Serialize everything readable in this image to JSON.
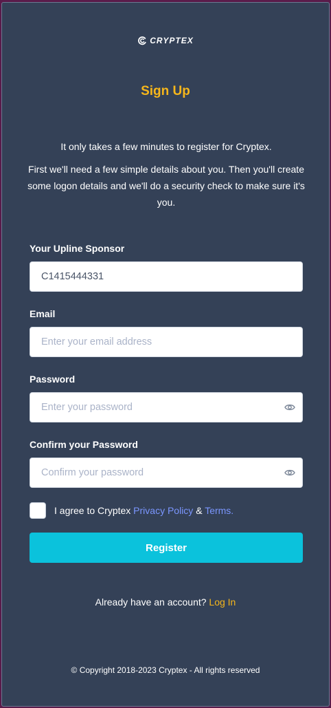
{
  "brand": {
    "name": "CRYPTEX",
    "logo_icon": "cryptex-swirl-icon"
  },
  "page": {
    "title": "Sign Up",
    "intro_line1": "It only takes a few minutes to register for Cryptex.",
    "intro_line2": "First we'll need a few simple details about you. Then you'll create some logon details and we'll do a security check to make sure it's you."
  },
  "form": {
    "sponsor": {
      "label": "Your Upline Sponsor",
      "value": "C1415444331",
      "placeholder": ""
    },
    "email": {
      "label": "Email",
      "value": "",
      "placeholder": "Enter your email address"
    },
    "password": {
      "label": "Password",
      "value": "",
      "placeholder": "Enter your password",
      "icon": "eye-icon"
    },
    "confirm_password": {
      "label": "Confirm your Password",
      "value": "",
      "placeholder": "Confirm your password",
      "icon": "eye-icon"
    },
    "agree": {
      "checked": false,
      "prefix": "I agree to Cryptex",
      "privacy_link": "Privacy Policy",
      "joiner": "&",
      "terms_link": "Terms."
    },
    "register_label": "Register"
  },
  "footer": {
    "have_account": "Already have an account?",
    "login_link": "Log In",
    "copyright": "© Copyright 2018-2023 Cryptex - All rights reserved"
  },
  "colors": {
    "background": "#344157",
    "accent_yellow": "#f6b61b",
    "button_cyan": "#0bc2dc",
    "link_blue": "#7b96ff"
  }
}
